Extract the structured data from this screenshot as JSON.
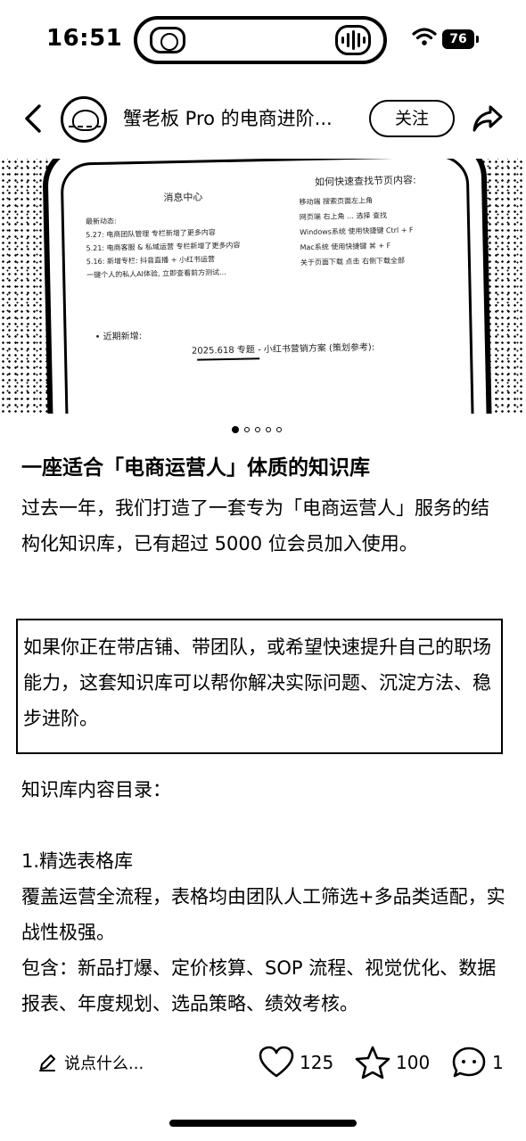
{
  "status": {
    "time": "16:51",
    "battery": "76"
  },
  "header": {
    "author": "蟹老板 Pro 的电商进阶...",
    "follow_label": "关注"
  },
  "hero": {
    "title_left": "消息中心",
    "title_right": "如何快速查找节页内容:",
    "list_left": [
      "最新动态:",
      "5.27: 电商团队管理 专栏新增了更多内容",
      "5.21: 电商客服 & 私域运营 专栏新增了更多内容",
      "5.16: 新增专栏: 抖音直播 + 小红书运营",
      "一键个人的私人AI体验, 立即查看前方测试..."
    ],
    "list_right": [
      "移动端  搜索页面左上角",
      "网页端  右上角 … 选择 查找",
      "Windows系统  使用快捷键 Ctrl + F",
      "Mac系统  使用快捷键 ⌘ + F",
      "关于页面下载  点击 右侧下载全部"
    ],
    "footer_left": "• 近期新增:",
    "footer_center": "2025.618 专题 - 小红书营销方案 (策划参考):"
  },
  "carousel": {
    "total": 5,
    "active": 0
  },
  "post": {
    "title": "一座适合「电商运营人」体质的知识库",
    "intro": "过去一年，我们打造了一套专为「电商运营人」服务的结构化知识库，已有超过 5000 位会员加入使用。",
    "callout": "如果你正在带店铺、带团队，或希望快速提升自己的职场能力，这套知识库可以帮你解决实际问题、沉淀方法、稳步进阶。",
    "toc_heading": "知识库内容目录：",
    "section1_title": "1.精选表格库",
    "section1_desc": "覆盖运营全流程，表格均由团队人工筛选+多品类适配，实战性极强。",
    "section1_includes": "包含：新品打爆、定价核算、SOP 流程、视觉优化、数据报表、年度规划、选品策略、绩效考核。"
  },
  "bottom_bar": {
    "comment_placeholder": "说点什么...",
    "likes": "125",
    "favorites": "100",
    "comments": "1"
  }
}
